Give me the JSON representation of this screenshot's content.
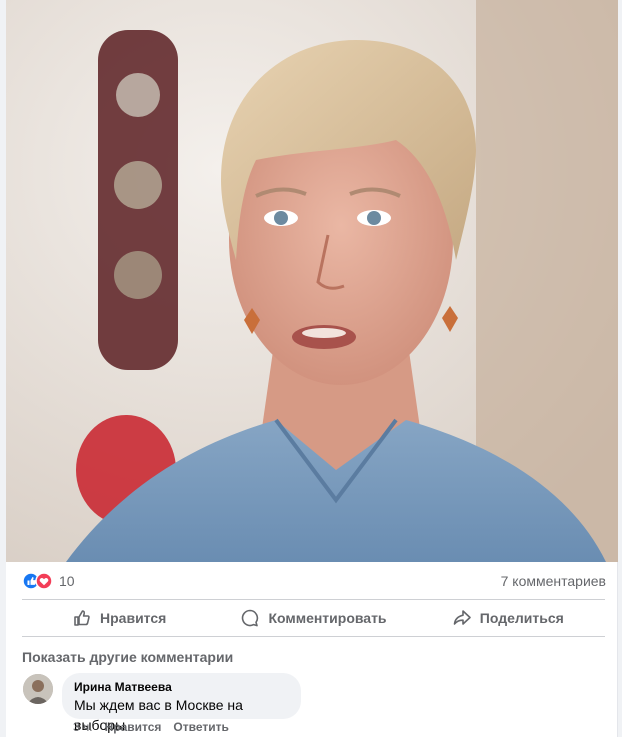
{
  "post": {
    "reactions": {
      "count": "10",
      "icons": [
        "like-icon",
        "love-icon"
      ],
      "like_color": "#1877f2",
      "love_color": "#f33e58"
    },
    "comments_count": "7 комментариев"
  },
  "actions": {
    "like": "Нравится",
    "comment": "Комментировать",
    "share": "Поделиться"
  },
  "comments": {
    "show_more": "Показать другие комментарии",
    "items": [
      {
        "author": "Ирина Матвеева",
        "text": "Мы ждем вас в Москве на выборы",
        "time": "3 ч.",
        "like_label": "Нравится",
        "reply_label": "Ответить"
      }
    ]
  }
}
